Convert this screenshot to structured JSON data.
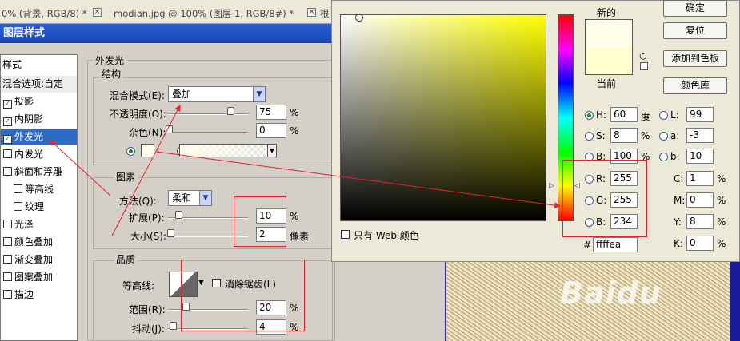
{
  "tabs": [
    {
      "label": "0% (背景, RGB/8) *"
    },
    {
      "label": "modian.jpg @ 100% (图层 1, RGB/8#) *"
    },
    {
      "label": "根"
    }
  ],
  "dialog": {
    "title": "图层样式",
    "styles_header": "样式",
    "blend_options": "混合选项:自定",
    "styles": [
      {
        "label": "投影",
        "checked": true
      },
      {
        "label": "内阴影",
        "checked": true
      },
      {
        "label": "外发光",
        "checked": true
      },
      {
        "label": "内发光",
        "checked": false
      },
      {
        "label": "斜面和浮雕",
        "checked": false
      },
      {
        "label": "等高线",
        "checked": false
      },
      {
        "label": "纹理",
        "checked": false
      },
      {
        "label": "光泽",
        "checked": false
      },
      {
        "label": "颜色叠加",
        "checked": false
      },
      {
        "label": "渐变叠加",
        "checked": false
      },
      {
        "label": "图案叠加",
        "checked": false
      },
      {
        "label": "描边",
        "checked": false
      }
    ],
    "outer_glow": "外发光",
    "structure": "结构",
    "blend_mode_label": "混合模式(E):",
    "blend_mode_value": "叠加",
    "opacity_label": "不透明度(O):",
    "opacity_value": "75",
    "noise_label": "杂色(N):",
    "noise_value": "0",
    "percent": "%",
    "elements": "图素",
    "method_label": "方法(Q):",
    "method_value": "柔和",
    "spread_label": "扩展(P):",
    "spread_value": "10",
    "size_label": "大小(S):",
    "size_value": "2",
    "px": "像素",
    "quality": "品质",
    "contour_label": "等高线:",
    "antialias_label": "消除锯齿(L)",
    "range_label": "范围(R):",
    "range_value": "20",
    "jitter_label": "抖动(J):",
    "jitter_value": "4"
  },
  "picker": {
    "new_label": "新的",
    "current_label": "当前",
    "swatch_color": "#ffffea",
    "buttons": {
      "ok": "确定",
      "reset": "复位",
      "add": "添加到色板",
      "library": "颜色库"
    },
    "hsb": [
      {
        "k": "H:",
        "v": "60",
        "u": "度",
        "on": true
      },
      {
        "k": "S:",
        "v": "8",
        "u": "%",
        "on": false
      },
      {
        "k": "B:",
        "v": "100",
        "u": "%",
        "on": false
      }
    ],
    "rgb": [
      {
        "k": "R:",
        "v": "255"
      },
      {
        "k": "G:",
        "v": "255"
      },
      {
        "k": "B:",
        "v": "234"
      }
    ],
    "lab": [
      {
        "k": "L:",
        "v": "99"
      },
      {
        "k": "a:",
        "v": "-3"
      },
      {
        "k": "b:",
        "v": "10"
      }
    ],
    "cmyk": [
      {
        "k": "C:",
        "v": "1"
      },
      {
        "k": "M:",
        "v": "0"
      },
      {
        "k": "Y:",
        "v": "8"
      },
      {
        "k": "K:",
        "v": "0"
      }
    ],
    "hex_label": "#",
    "hex": "ffffea",
    "web_only": "只有 Web 颜色"
  },
  "watermark": "Baidu"
}
